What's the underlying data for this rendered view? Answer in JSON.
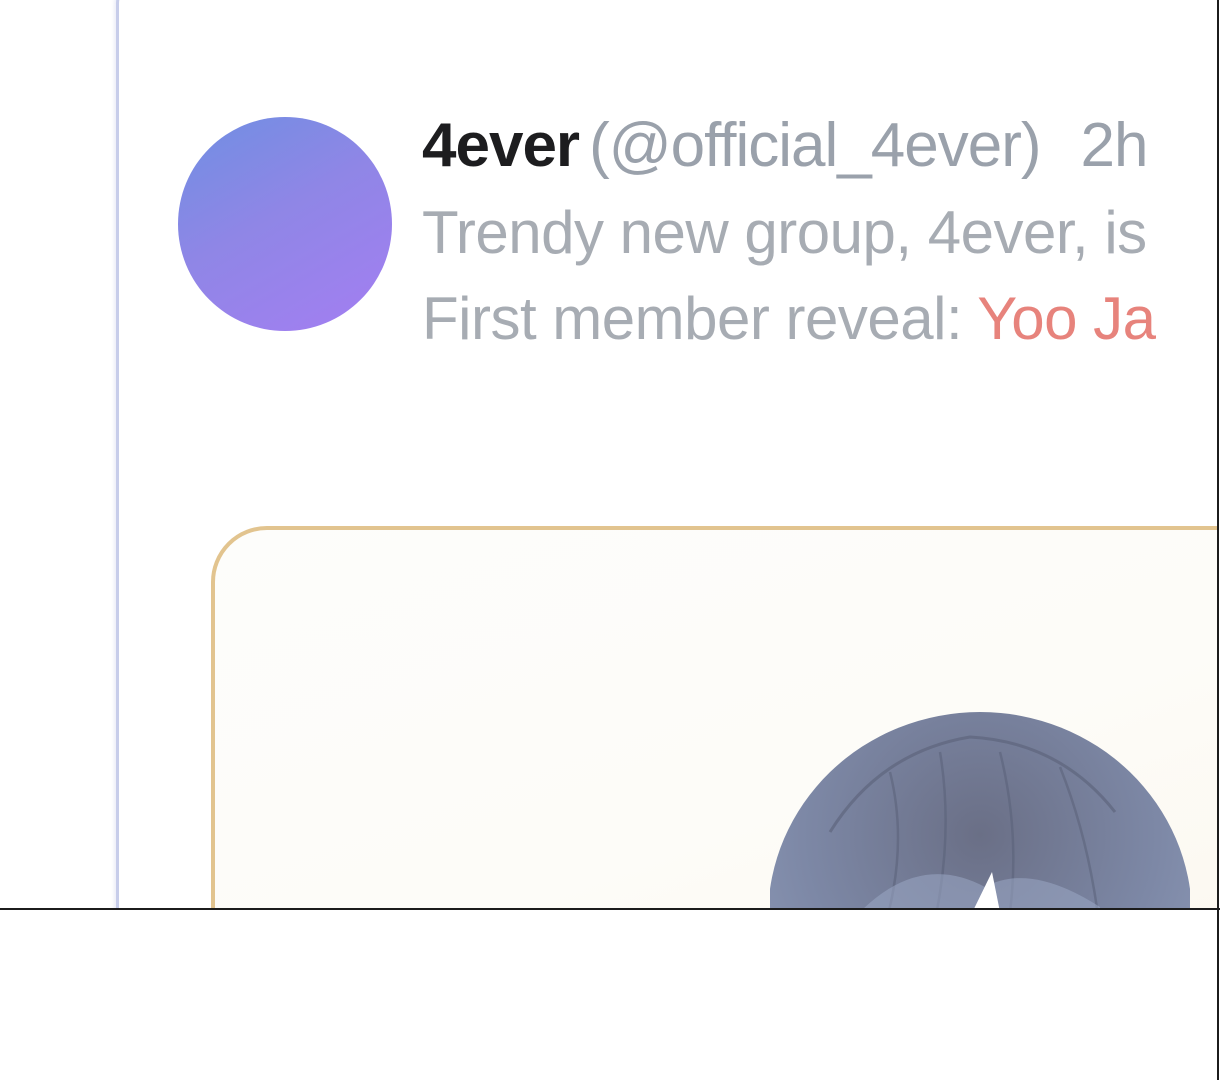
{
  "post": {
    "author_name": "4ever",
    "author_handle": "(@official_4ever)",
    "time": "2h",
    "line1": "Trendy new group, 4ever, is",
    "line2_prefix": "First member reveal: ",
    "line2_highlight": "Yoo Ja"
  },
  "colors": {
    "avatar_start": "#6f8fe2",
    "avatar_end": "#a47ef2",
    "highlight": "#e7837c",
    "card_border": "#c7cdea",
    "photo_border": "#e2c48f"
  },
  "icons": {
    "avatar": "gradient-circle-avatar",
    "photo": "character-head-illustration"
  }
}
